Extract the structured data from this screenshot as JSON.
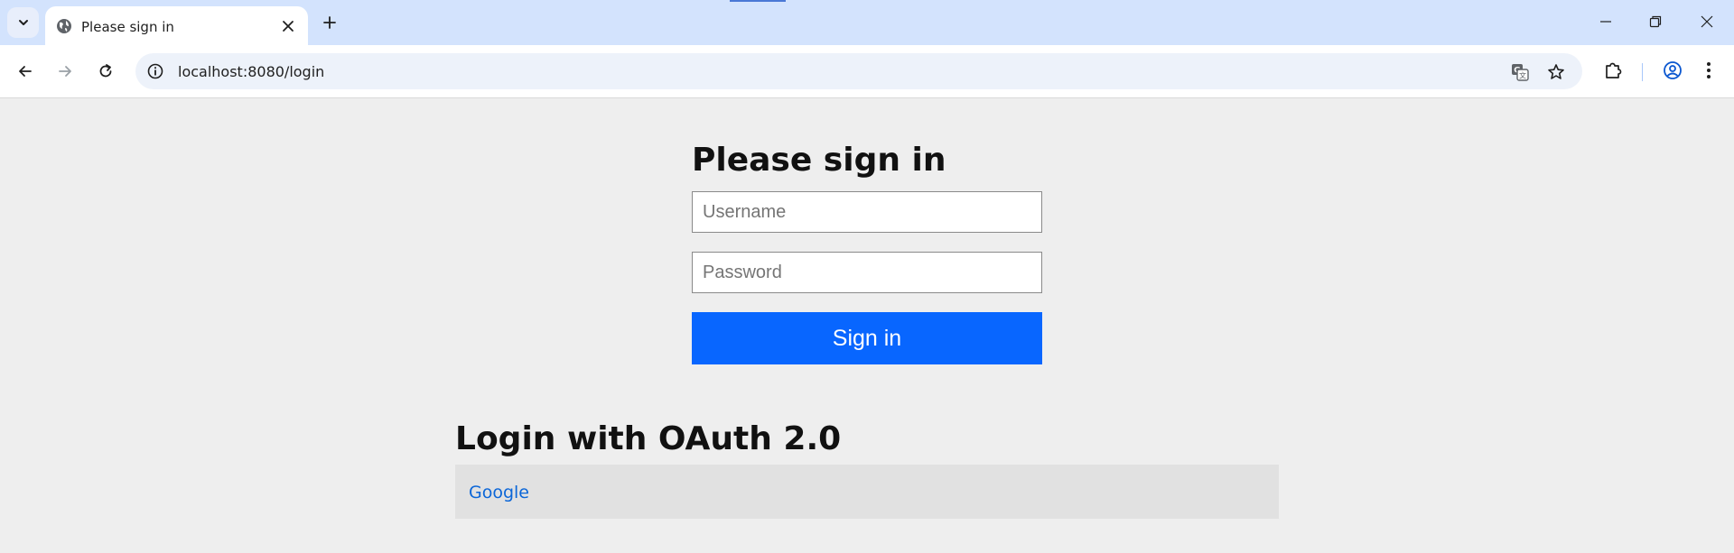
{
  "browser": {
    "tab_title": "Please sign in",
    "url": "localhost:8080/login",
    "icons": {
      "tab_search": "chevron-down-icon",
      "tab_favicon": "globe-icon",
      "tab_close": "close-icon",
      "new_tab": "plus-icon",
      "back": "arrow-left-icon",
      "forward": "arrow-right-icon",
      "reload": "reload-icon",
      "site_info": "info-icon",
      "translate": "translate-icon",
      "bookmark": "star-icon",
      "extensions": "puzzle-icon",
      "profile": "profile-icon",
      "menu": "kebab-menu-icon"
    },
    "colors": {
      "tabstrip": "#d3e3fd",
      "omnibox": "#edf2fa",
      "profile": "#0b57d0"
    }
  },
  "login": {
    "heading": "Please sign in",
    "username_placeholder": "Username",
    "password_placeholder": "Password",
    "submit_label": "Sign in",
    "button_color": "#0866ff"
  },
  "oauth": {
    "heading": "Login with OAuth 2.0",
    "providers": [
      {
        "label": "Google",
        "color": "#0b66d8"
      }
    ]
  }
}
